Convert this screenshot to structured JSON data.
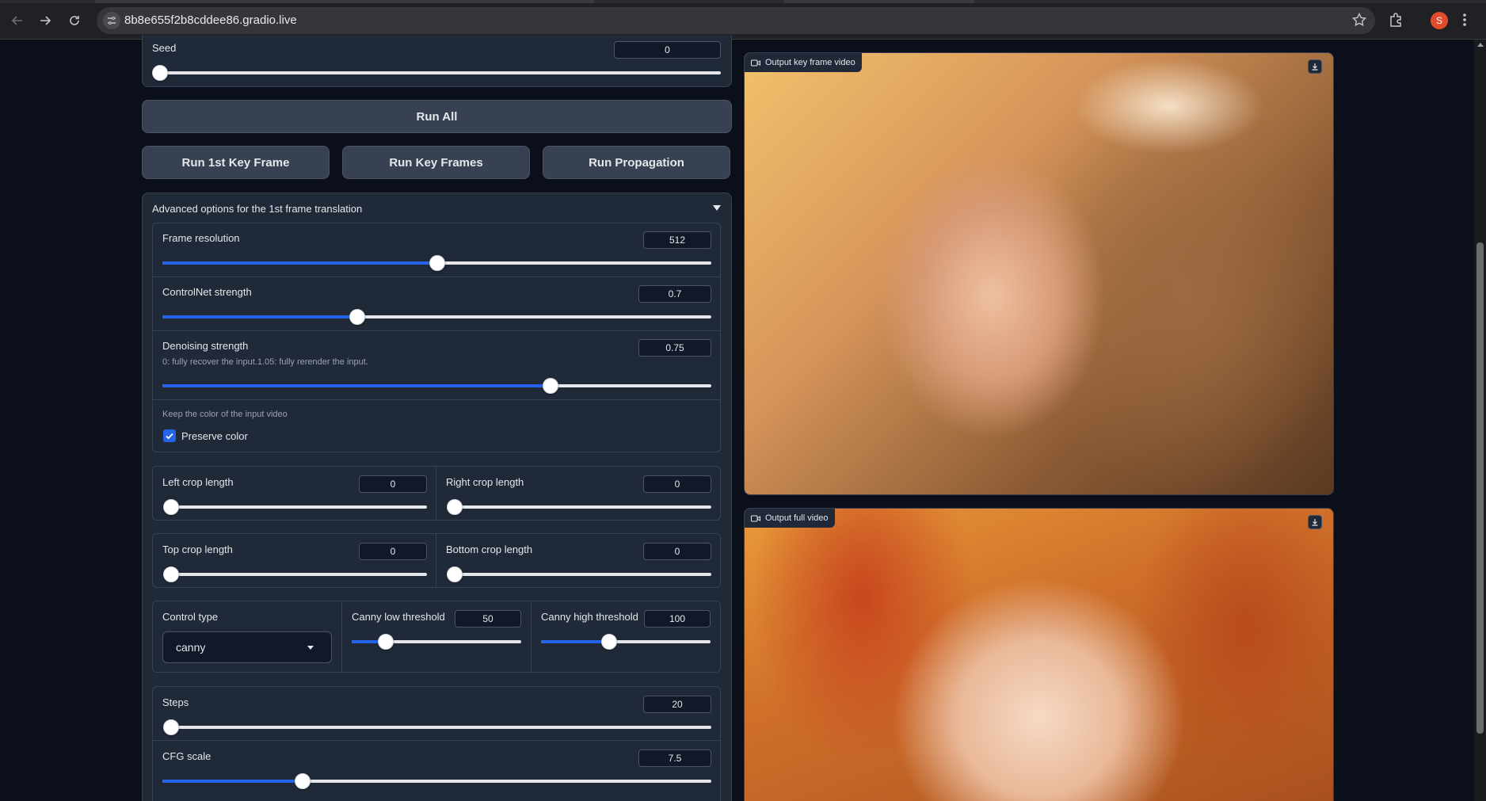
{
  "browser": {
    "url": "8b8e655f2b8cddee86.gradio.live",
    "profile_initial": "S"
  },
  "seed": {
    "label": "Seed",
    "value": "0",
    "level": 0
  },
  "buttons": {
    "run_all": "Run All",
    "run_first": "Run 1st Key Frame",
    "run_key_frames": "Run Key Frames",
    "run_propagation": "Run Propagation"
  },
  "advanced": {
    "title": "Advanced options for the 1st frame translation",
    "frame_resolution": {
      "label": "Frame resolution",
      "value": "512",
      "level": 0.5
    },
    "controlnet_strength": {
      "label": "ControlNet strength",
      "value": "0.7",
      "level": 0.355
    },
    "denoising_strength": {
      "label": "Denoising strength",
      "info": "0: fully recover the input.1.05: fully rerender the input.",
      "value": "0.75",
      "level": 0.707
    },
    "color_info": "Keep the color of the input video",
    "preserve_color": {
      "label": "Preserve color",
      "checked": true
    },
    "left_crop": {
      "label": "Left crop length",
      "value": "0",
      "level": 0
    },
    "right_crop": {
      "label": "Right crop length",
      "value": "0",
      "level": 0
    },
    "top_crop": {
      "label": "Top crop length",
      "value": "0",
      "level": 0
    },
    "bottom_crop": {
      "label": "Bottom crop length",
      "value": "0",
      "level": 0
    },
    "control_type": {
      "label": "Control type",
      "value": "canny"
    },
    "canny_low": {
      "label": "Canny low threshold",
      "value": "50",
      "level": 0.2
    },
    "canny_high": {
      "label": "Canny high threshold",
      "value": "100",
      "level": 0.4
    },
    "steps": {
      "label": "Steps",
      "value": "20",
      "level": 0
    },
    "cfg_scale": {
      "label": "CFG scale",
      "value": "7.5",
      "level": 0.255
    }
  },
  "outputs": {
    "key_frame_label": "Output key frame video",
    "full_label": "Output full video"
  },
  "colors": {
    "accent": "#2563eb",
    "panel": "#1f2937",
    "background": "#0b0f19"
  },
  "icons": [
    "back-arrow-icon",
    "forward-arrow-icon",
    "reload-icon",
    "site-settings-icon",
    "bookmark-star-icon",
    "extensions-icon",
    "more-menu-icon",
    "video-camera-icon",
    "download-icon",
    "checkmark-icon"
  ]
}
